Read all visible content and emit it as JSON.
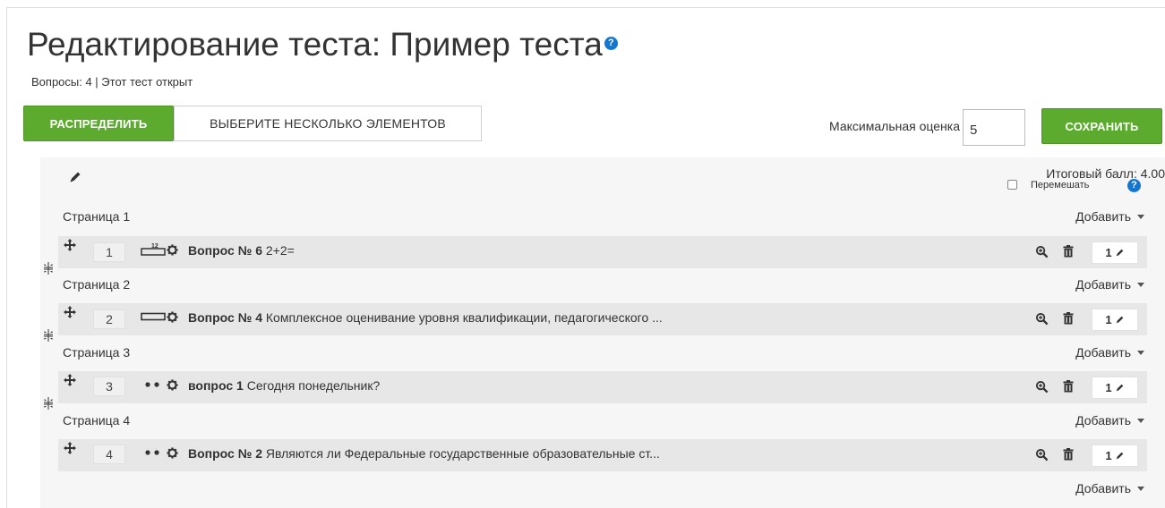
{
  "header": {
    "title": "Редактирование теста: Пример теста",
    "help_icon": "question-circle-icon",
    "help_symbol": "?",
    "status": "Вопросы: 4 | Этот тест открыт"
  },
  "toolbar": {
    "distribute_label": "РАСПРЕДЕЛИТЬ",
    "select_multiple_label": "ВЫБЕРИТЕ НЕСКОЛЬКО ЭЛЕМЕНТОВ",
    "max_grade_label": "Максимальная оценка",
    "max_grade_value": "5",
    "save_label": "СОХРАНИТЬ"
  },
  "summary": {
    "total_score": "Итоговый балл: 4.00",
    "shuffle_label": "Перемешать",
    "shuffle_checked": false
  },
  "pages": [
    {
      "label": "Страница 1",
      "add_label": "Добавить",
      "question": {
        "slot": "1",
        "type_icon": "numerical-icon",
        "title": "Вопрос № 6",
        "text": "2+2=",
        "mark": "1"
      }
    },
    {
      "label": "Страница 2",
      "add_label": "Добавить",
      "question": {
        "slot": "2",
        "type_icon": "short-answer-icon",
        "title": "Вопрос № 4",
        "text": "Комплексное оценивание уровня квалификации, педагогического ...",
        "mark": "1"
      }
    },
    {
      "label": "Страница 3",
      "add_label": "Добавить",
      "question": {
        "slot": "3",
        "type_icon": "true-false-icon",
        "title": "вопрос 1",
        "text": "Сегодня понедельник?",
        "mark": "1"
      }
    },
    {
      "label": "Страница 4",
      "add_label": "Добавить",
      "question": {
        "slot": "4",
        "type_icon": "true-false-icon",
        "title": "Вопрос № 2",
        "text": "Являются ли Федеральные государственные образовательные ст...",
        "mark": "1"
      }
    }
  ],
  "final_add_label": "Добавить",
  "colors": {
    "accent_green": "#5cab2e",
    "help_blue": "#1177d1",
    "panel_bg": "#f6f6f6",
    "row_bg": "#e7e7e7"
  }
}
